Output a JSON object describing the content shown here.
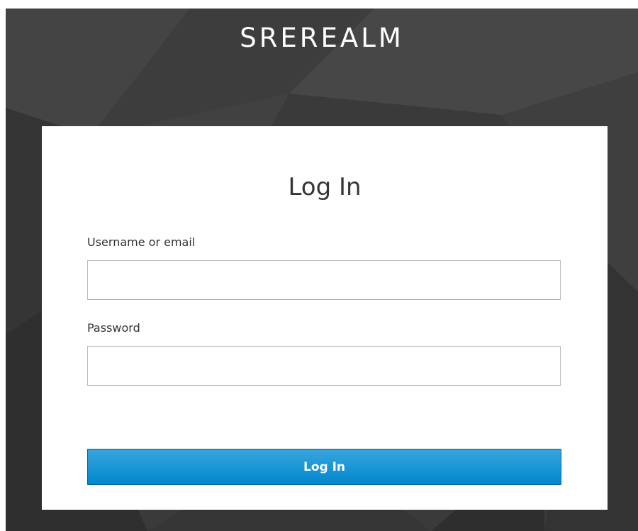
{
  "realm": {
    "title": "SREREALM"
  },
  "login_form": {
    "heading": "Log In",
    "username": {
      "label": "Username or email",
      "value": ""
    },
    "password": {
      "label": "Password",
      "value": ""
    },
    "submit_label": "Log In"
  },
  "colors": {
    "background": "#3a3a3a",
    "card": "#ffffff",
    "button_top": "#39a5dc",
    "button_bottom": "#0088ce",
    "button_border": "#00659c"
  }
}
